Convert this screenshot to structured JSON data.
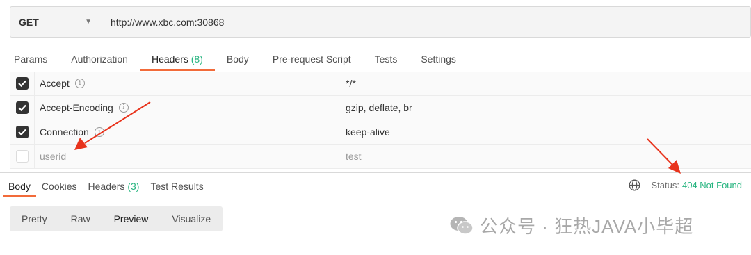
{
  "request": {
    "method": "GET",
    "url": "http://www.xbc.com:30868"
  },
  "request_tabs": [
    {
      "label": "Params"
    },
    {
      "label": "Authorization"
    },
    {
      "label": "Headers",
      "count": "(8)"
    },
    {
      "label": "Body"
    },
    {
      "label": "Pre-request Script"
    },
    {
      "label": "Tests"
    },
    {
      "label": "Settings"
    }
  ],
  "headers": [
    {
      "key": "Accept",
      "value": "*/*",
      "checked": true
    },
    {
      "key": "Accept-Encoding",
      "value": "gzip, deflate, br",
      "checked": true
    },
    {
      "key": "Connection",
      "value": "keep-alive",
      "checked": true
    },
    {
      "key": "userid",
      "value": "test",
      "checked": false
    }
  ],
  "response_tabs": [
    {
      "label": "Body"
    },
    {
      "label": "Cookies"
    },
    {
      "label": "Headers",
      "count": "(3)"
    },
    {
      "label": "Test Results"
    }
  ],
  "status": {
    "label": "Status:",
    "code": "404 Not Found"
  },
  "view_modes": [
    "Pretty",
    "Raw",
    "Preview",
    "Visualize"
  ],
  "watermark": {
    "text": "公众号 · 狂热JAVA小毕超"
  },
  "colors": {
    "accent": "#f26b3a",
    "status_green": "#26b47f",
    "annotation_arrow": "#e8331c"
  }
}
